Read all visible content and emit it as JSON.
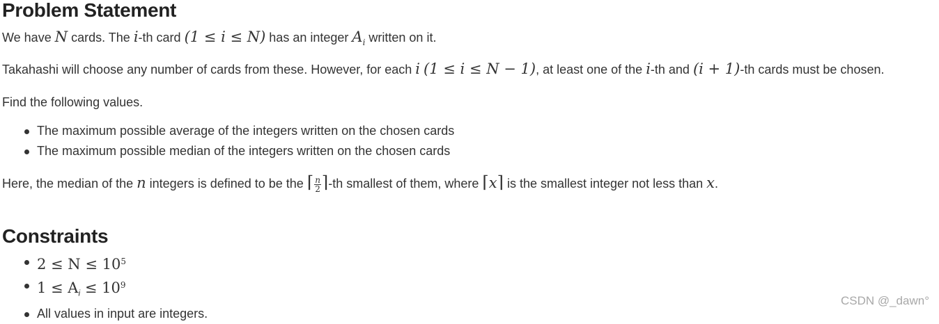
{
  "headings": {
    "problem": "Problem Statement",
    "constraints": "Constraints"
  },
  "problem": {
    "p1": {
      "t1": "We have ",
      "m1": "N",
      "t2": " cards. The ",
      "m2": "i",
      "t3": "-th card ",
      "m3": "(1 ≤ i ≤ N)",
      "t4": " has an integer ",
      "m4": "A",
      "m4sub": "i",
      "t5": " written on it."
    },
    "p2": {
      "t1": "Takahashi will choose any number of cards from these. However, for each ",
      "m1": "i",
      "t2": " ",
      "m2": "(1 ≤ i ≤ N − 1)",
      "t3": ", at least one of the ",
      "m3": "i",
      "t4": "-th and ",
      "m4": "(i + 1)",
      "t5": "-th cards must be chosen."
    },
    "p3": "Find the following values.",
    "bullets": [
      "The maximum possible average of the integers written on the chosen cards",
      "The maximum possible median of the integers written on the chosen cards"
    ],
    "p4": {
      "t1": "Here, the median of the ",
      "m1": "n",
      "t2": " integers is defined to be the ",
      "frac_num": "n",
      "frac_den": "2",
      "t3": "-th smallest of them, where ",
      "m2": "x",
      "t4": " is the smallest integer not less than ",
      "m3": "x",
      "t5": "."
    }
  },
  "constraints": {
    "c1": {
      "m": "2 ≤ N ≤ 10",
      "sup": "5"
    },
    "c2": {
      "m1": "1 ≤ A",
      "sub": "i",
      "m2": " ≤ 10",
      "sup": "9"
    },
    "c3": "All values in input are integers."
  },
  "watermark": "CSDN @_dawn°"
}
